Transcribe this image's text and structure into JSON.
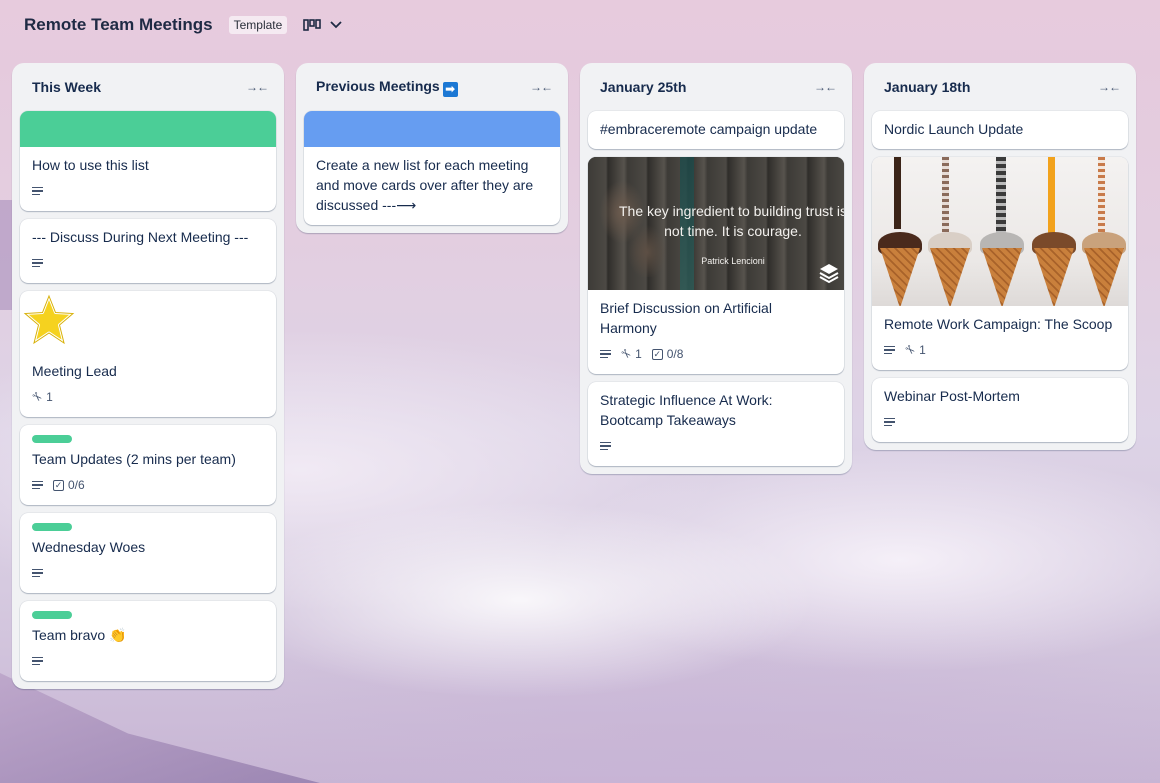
{
  "board": {
    "title": "Remote Team Meetings",
    "template_badge": "Template",
    "view_icon": "board-view-icon",
    "chevron": "⌵"
  },
  "lists": [
    {
      "title": "This Week",
      "cards": [
        {
          "title": "How to use this list",
          "cover_color": "#4bce97",
          "has_description": true
        },
        {
          "title": "--- Discuss During Next Meeting ---",
          "has_description": true
        },
        {
          "title": "Meeting Lead",
          "sticker": "star",
          "attachments": "1"
        },
        {
          "title": "Team Updates (2 mins per team)",
          "label_color": "#4bce97",
          "has_description": true,
          "checklist": "0/6"
        },
        {
          "title": "Wednesday Woes",
          "label_color": "#4bce97",
          "has_description": true
        },
        {
          "title": "Team bravo 👏",
          "label_color": "#4bce97",
          "has_description": true
        }
      ]
    },
    {
      "title": "Previous Meetings",
      "title_emoji": "➡",
      "cards": [
        {
          "title": "Create a new list for each meeting and move cards over after they are discussed ---⟶",
          "cover_color": "#669df1"
        }
      ]
    },
    {
      "title": "January 25th",
      "cards": [
        {
          "title": "#embraceremote campaign update"
        },
        {
          "title": "Brief Discussion on Artificial Harmony",
          "image": {
            "quote": "The key ingredient to building trust is not time. It is courage.",
            "author": "Patrick Lencioni"
          },
          "has_description": true,
          "attachments": "1",
          "checklist": "0/8"
        },
        {
          "title": "Strategic Influence At Work: Bootcamp Takeaways",
          "has_description": true
        }
      ]
    },
    {
      "title": "January 18th",
      "cards": [
        {
          "title": "Nordic Launch Update"
        },
        {
          "title": "Remote Work Campaign: The Scoop",
          "image": "ice-cream-cones",
          "has_description": true,
          "attachments": "1"
        },
        {
          "title": "Webinar Post-Mortem",
          "has_description": true
        }
      ]
    }
  ],
  "icons": {
    "collapse": "collapse-list-icon",
    "description": "description-icon",
    "attachment": "paperclip-icon",
    "checklist": "checklist-icon"
  }
}
